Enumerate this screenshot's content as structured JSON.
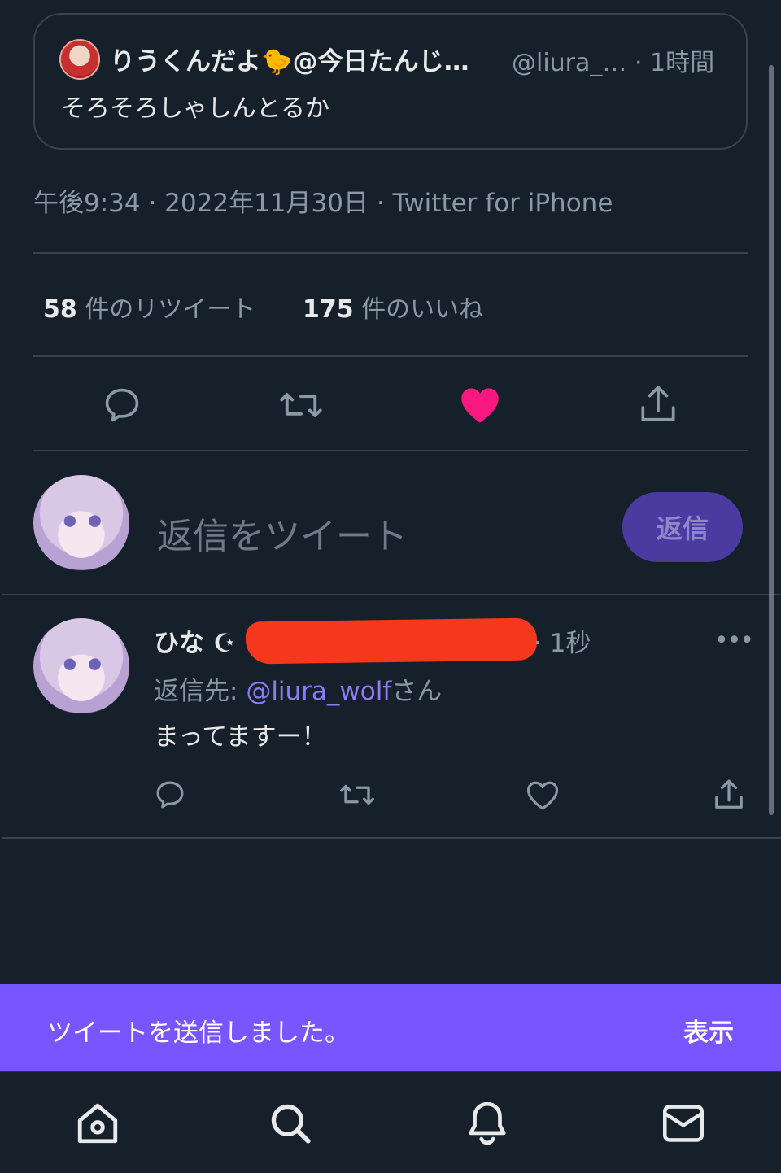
{
  "quoted_tweet": {
    "name": "りうくんだよ🐤@今日たんじ…",
    "handle_time": "@liura_… · 1時間",
    "text": "そろそろしゃしんとるか"
  },
  "tweet_meta": {
    "timestamp": "午後9:34 · 2022年11月30日 · Twitter for iPhone"
  },
  "stats": {
    "retweets_count": "58",
    "retweets_label": "件のリツイート",
    "likes_count": "175",
    "likes_label": "件のいいね"
  },
  "actions": {
    "liked": true,
    "like_color": "#f91880"
  },
  "composer": {
    "placeholder": "返信をツイート",
    "reply_button": "返信"
  },
  "reply": {
    "name": "ひな ☪︎",
    "time": "· 1秒",
    "more": "•••",
    "reply_to_prefix": "返信先: ",
    "reply_to_mention": "@liura_wolf",
    "reply_to_suffix": "さん",
    "text": "まってますー！"
  },
  "toast": {
    "message": "ツイートを送信しました。",
    "action": "表示",
    "color": "#7856ff"
  },
  "bottom_nav": {
    "items": [
      "home-icon",
      "search-icon",
      "notifications-icon",
      "messages-icon"
    ]
  }
}
